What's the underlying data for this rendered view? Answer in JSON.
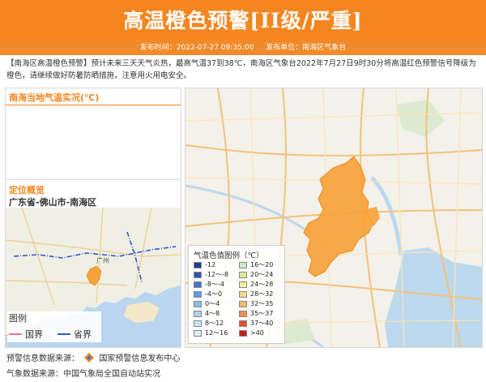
{
  "header": {
    "title": "高温橙色预警[II级/严重]",
    "publish_time": "发布时间：2022-07-27 09:35:00",
    "publisher": "发布单位：南海区气象台"
  },
  "description": "【南海区高温橙色预警】预计未来三天天气炎热，最高气温37到38℃，南海区气象台2022年7月27日9时30分将高温红色预警信号降级为橙色，请继续做好防暑防晒措施，注意用火用电安全。",
  "temp_panel": {
    "title": "南海当地气温实况(℃)"
  },
  "location_panel": {
    "title": "定位概览",
    "path": "广东省-佛山市-南海区",
    "map_city_label": "广州",
    "legend": {
      "title": "图例",
      "items": [
        {
          "label": "国界",
          "color": "#e07a8a"
        },
        {
          "label": "省界",
          "color": "#2f5bd6"
        }
      ]
    }
  },
  "temp_legend": {
    "title": "气温色值图例（℃）",
    "left": [
      {
        "label": "-12",
        "color": "#1f3c8f"
      },
      {
        "label": "-12～-8",
        "color": "#2c55b4"
      },
      {
        "label": "-8～-4",
        "color": "#3d78d6"
      },
      {
        "label": "-4～0",
        "color": "#5b9ce8"
      },
      {
        "label": "0～4",
        "color": "#84c0f0"
      },
      {
        "label": "4～8",
        "color": "#a9d6f2"
      },
      {
        "label": "8～12",
        "color": "#c8e6f5"
      },
      {
        "label": "12～16",
        "color": "#d9f0f0"
      }
    ],
    "right": [
      {
        "label": "16～20",
        "color": "#cfeac0"
      },
      {
        "label": "20～24",
        "color": "#d9ec99"
      },
      {
        "label": "24～28",
        "color": "#f4ed9a"
      },
      {
        "label": "28～32",
        "color": "#f9d98b"
      },
      {
        "label": "32～35",
        "color": "#f7b775"
      },
      {
        "label": "35～37",
        "color": "#f28d4d"
      },
      {
        "label": "37～40",
        "color": "#e44f2a"
      },
      {
        "label": ">40",
        "color": "#c0201a"
      }
    ]
  },
  "footer": {
    "warning_source_prefix": "预警信息数据来源：",
    "warning_source_name": "国家预警信息发布中心",
    "weather_source": "气象数据来源：中国气象局全国自动站实况"
  },
  "colors": {
    "brand": "#f5861f",
    "warning_area": "#f7a23a"
  }
}
